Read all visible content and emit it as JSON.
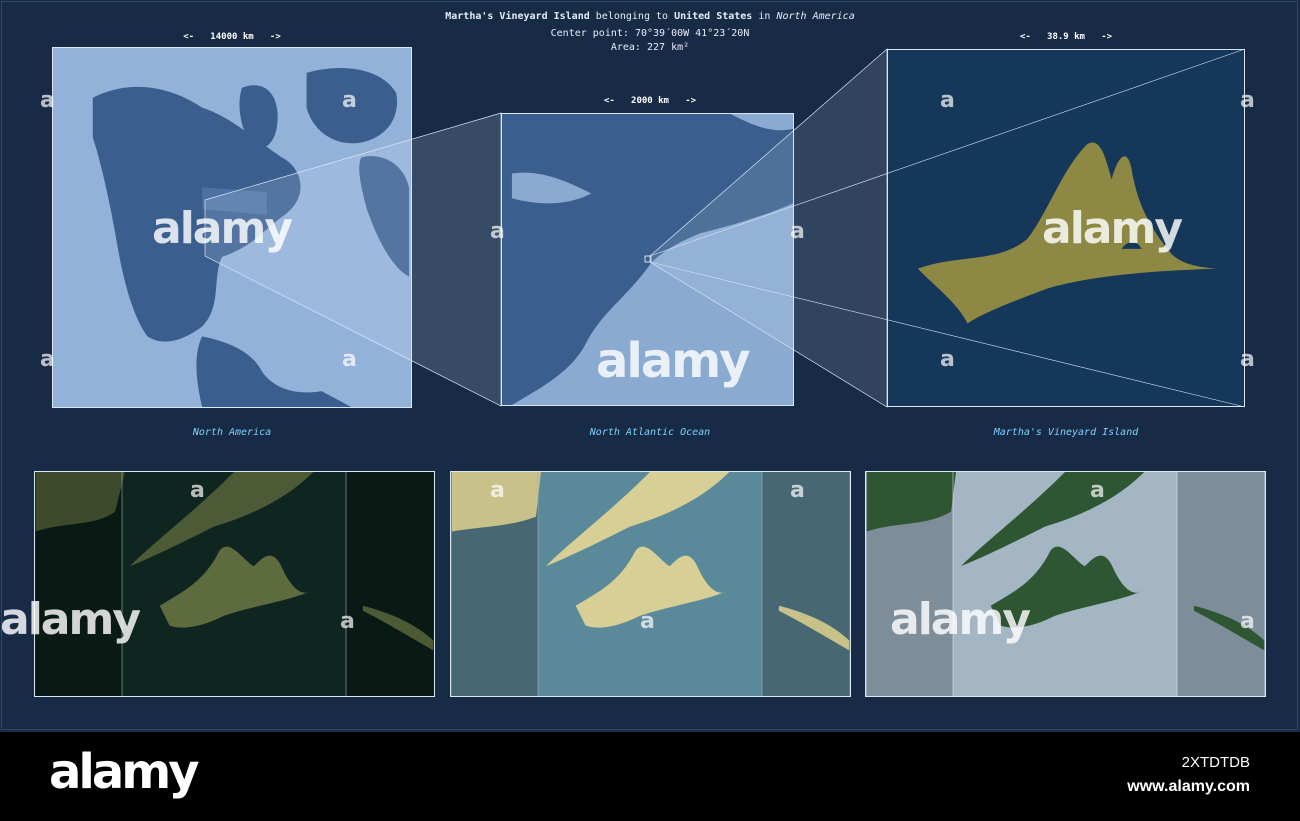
{
  "header": {
    "place": "Martha's Vineyard Island",
    "belonging": "belonging to",
    "country": "United States",
    "in": "in",
    "continent": "North America",
    "center_label": "Center point:",
    "center_value": "70°39´00W  41°23´20N",
    "area_label": "Area:",
    "area_value": "227 km²"
  },
  "scales": {
    "left": "<-   14000 km   ->",
    "middle": "<-   2000 km   ->",
    "right": "<-   38.9 km   ->"
  },
  "captions": {
    "left": "North America",
    "middle": "North Atlantic Ocean",
    "right": "Martha's Vineyard Island"
  },
  "watermark": {
    "text": "alamy",
    "corner": "a"
  },
  "footer": {
    "logo": "alamy",
    "image_id": "2XTDTDB",
    "url": "www.alamy.com"
  },
  "colors": {
    "background": "#172b47",
    "ocean_light": "#8fb0d8",
    "land_dark": "#3a5f8f",
    "island": "#8d8944",
    "caption": "#7fd0ff"
  },
  "icons": [
    "alamy-a-watermark",
    "scale-arrow-left",
    "scale-arrow-right"
  ]
}
